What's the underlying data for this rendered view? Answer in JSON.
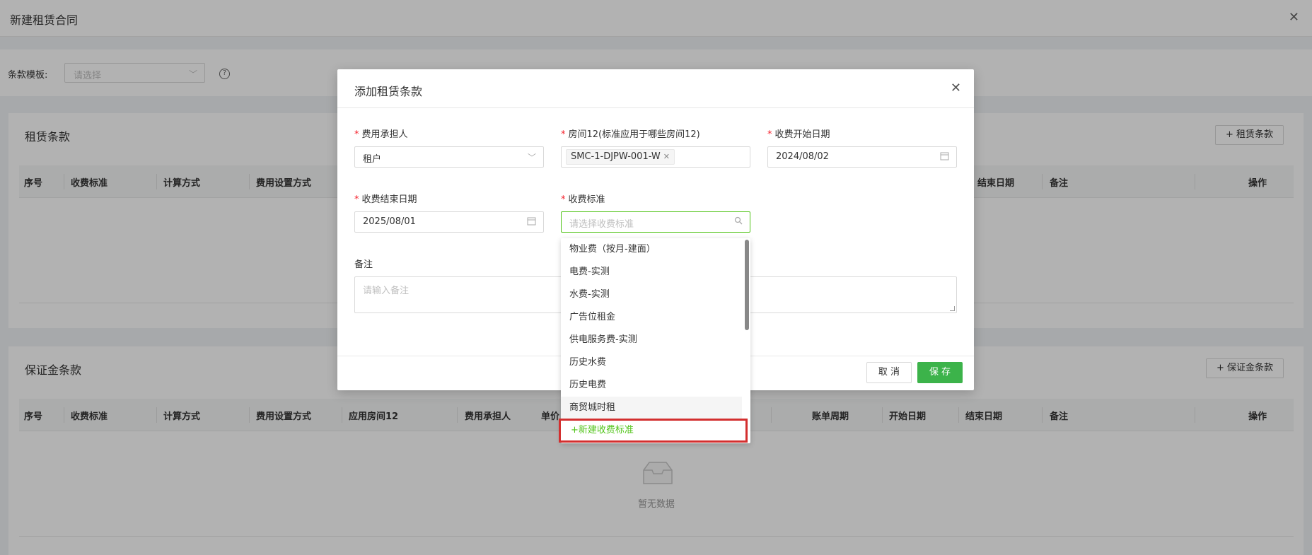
{
  "page": {
    "title": "新建租赁合同"
  },
  "template": {
    "label": "条款模板:",
    "placeholder": "请选择"
  },
  "rental_section": {
    "title": "租赁条款",
    "add_button": "+ 租赁条款",
    "columns": [
      "序号",
      "收费标准",
      "计算方式",
      "费用设置方式",
      "结束日期",
      "备注",
      "操作"
    ]
  },
  "deposit_section": {
    "title": "保证金条款",
    "add_button": "+ 保证金条款",
    "columns": [
      "序号",
      "收费标准",
      "计算方式",
      "费用设置方式",
      "应用房间12",
      "费用承担人",
      "单价",
      "账单周期",
      "开始日期",
      "结束日期",
      "备注",
      "操作"
    ],
    "empty_text": "暂无数据"
  },
  "modal": {
    "title": "添加租赁条款",
    "fields": {
      "payer": {
        "label": "费用承担人",
        "value": "租户"
      },
      "room": {
        "label": "房间12(标准应用于哪些房间12)",
        "tag": "SMC-1-DJPW-001-W"
      },
      "start_date": {
        "label": "收费开始日期",
        "value": "2024/08/02"
      },
      "end_date": {
        "label": "收费结束日期",
        "value": "2025/08/01"
      },
      "standard": {
        "label": "收费标准",
        "placeholder": "请选择收费标准"
      },
      "remark": {
        "label": "备注",
        "placeholder": "请输入备注"
      }
    },
    "cancel_label": "取 消",
    "save_label": "保 存"
  },
  "dropdown": {
    "items": [
      "物业费（按月-建面）",
      "电费-实测",
      "水费-实测",
      "广告位租金",
      "供电服务费-实测",
      "历史水费",
      "历史电费",
      "商贸城时租"
    ],
    "new_label": "+新建收费标准"
  },
  "colors": {
    "primary": "#3cb34a",
    "required": "#f5222d",
    "highlight": "#d32f2f"
  }
}
